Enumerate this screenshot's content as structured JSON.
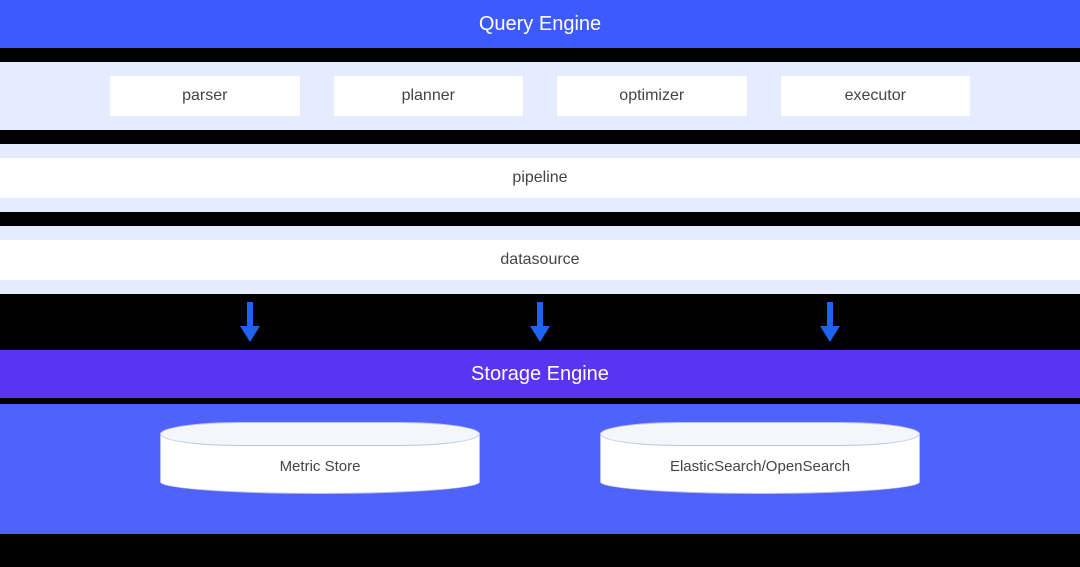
{
  "query_engine": {
    "title": "Query Engine",
    "components": {
      "parser": "parser",
      "planner": "planner",
      "optimizer": "optimizer",
      "executor": "executor"
    },
    "pipeline": "pipeline",
    "datasource": "datasource"
  },
  "storage_engine": {
    "title": "Storage Engine",
    "stores": {
      "metric": "Metric Store",
      "search": "ElasticSearch/OpenSearch"
    }
  },
  "colors": {
    "query_header": "#3D5AFE",
    "storage_header": "#5B33F2",
    "storage_body": "#4F62FB",
    "band": "#E6ECFF",
    "arrow": "#1E63F2"
  }
}
